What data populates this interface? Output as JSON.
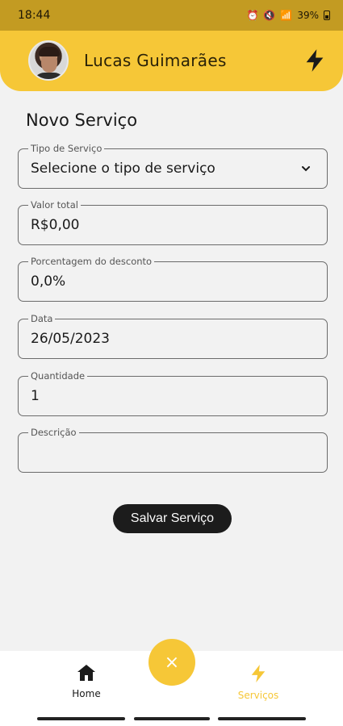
{
  "status_bar": {
    "time": "18:44",
    "battery": "39%"
  },
  "header": {
    "user_name": "Lucas Guimarães",
    "action_icon": "lightning-bolt-icon"
  },
  "page": {
    "title": "Novo Serviço"
  },
  "form": {
    "service_type": {
      "label": "Tipo de Serviço",
      "value": "Selecione o tipo de serviço"
    },
    "total_value": {
      "label": "Valor total",
      "value": "R$0,00"
    },
    "discount": {
      "label": "Porcentagem do desconto",
      "value": "0,0%"
    },
    "date": {
      "label": "Data",
      "value": "26/05/2023"
    },
    "quantity": {
      "label": "Quantidade",
      "value": "1"
    },
    "description": {
      "label": "Descrição",
      "value": ""
    },
    "save_label": "Salvar Serviço"
  },
  "bottom_nav": {
    "home_label": "Home",
    "services_label": "Serviços",
    "fab_icon": "close-icon",
    "fab_symbol": "×"
  },
  "colors": {
    "accent": "#f6c737",
    "dark": "#1c1c1c"
  }
}
